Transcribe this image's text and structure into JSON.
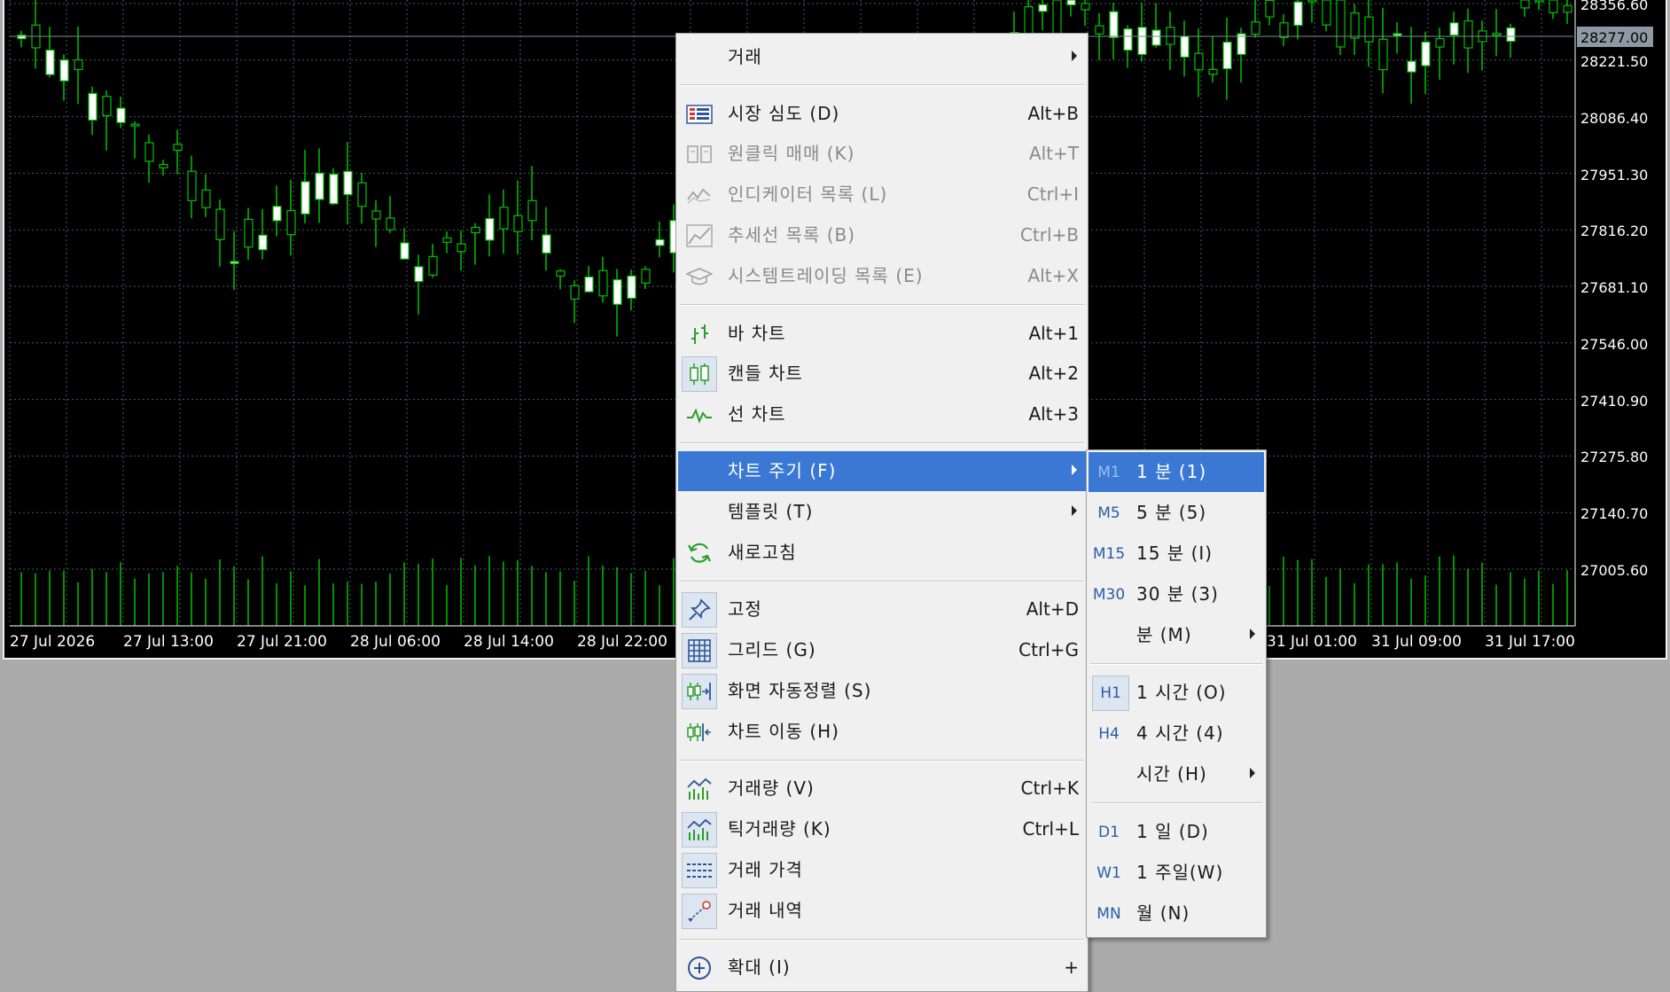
{
  "chart": {
    "price_ticks": [
      "28356.60",
      "28221.50",
      "28086.40",
      "27951.30",
      "27816.20",
      "27681.10",
      "27546.00",
      "27410.90",
      "27275.80",
      "27140.70",
      "27005.60"
    ],
    "current_price": "28277.00",
    "time_ticks": [
      "27 Jul 2026",
      "27 Jul 13:00",
      "27 Jul 21:00",
      "28 Jul 06:00",
      "28 Jul 14:00",
      "28 Jul 22:00",
      "31 Jul 01:00",
      "31 Jul 09:00",
      "31 Jul 17:00"
    ],
    "colors": {
      "background": "#000000",
      "grid": "#4a5a6a",
      "bull": "#00c000",
      "bear_body": "#ffffff",
      "volume": "#00c000"
    }
  },
  "context_menu": {
    "items": [
      {
        "label": "거래",
        "shortcut": "",
        "submenu": true
      },
      {
        "label": "시장 심도 (D)",
        "shortcut": "Alt+B",
        "icon": "market-depth-icon"
      },
      {
        "label": "원클릭 매매 (K)",
        "shortcut": "Alt+T",
        "icon": "one-click-trading-icon",
        "disabled": true
      },
      {
        "label": "인디케이터 목록 (L)",
        "shortcut": "Ctrl+I",
        "icon": "indicator-list-icon",
        "disabled": true
      },
      {
        "label": "추세선 목록 (B)",
        "shortcut": "Ctrl+B",
        "icon": "trendline-list-icon",
        "disabled": true
      },
      {
        "label": "시스템트레이딩 목록 (E)",
        "shortcut": "Alt+X",
        "icon": "expert-list-icon",
        "disabled": true
      },
      {
        "label": "바 차트",
        "shortcut": "Alt+1",
        "icon": "bar-chart-icon"
      },
      {
        "label": "캔들 차트",
        "shortcut": "Alt+2",
        "icon": "candle-chart-icon"
      },
      {
        "label": "선 차트",
        "shortcut": "Alt+3",
        "icon": "line-chart-icon"
      },
      {
        "label": "차트 주기 (F)",
        "shortcut": "",
        "submenu": true
      },
      {
        "label": "템플릿 (T)",
        "shortcut": "",
        "submenu": true
      },
      {
        "label": "새로고침",
        "shortcut": "",
        "icon": "refresh-icon"
      },
      {
        "label": "고정",
        "shortcut": "Alt+D",
        "icon": "pin-icon"
      },
      {
        "label": "그리드 (G)",
        "shortcut": "Ctrl+G",
        "icon": "grid-icon"
      },
      {
        "label": "화면 자동정렬 (S)",
        "shortcut": "",
        "icon": "autoscroll-icon"
      },
      {
        "label": "차트 이동 (H)",
        "shortcut": "",
        "icon": "chart-shift-icon"
      },
      {
        "label": "거래량 (V)",
        "shortcut": "Ctrl+K",
        "icon": "volume-icon"
      },
      {
        "label": "틱거래량 (K)",
        "shortcut": "Ctrl+L",
        "icon": "tick-volume-icon"
      },
      {
        "label": "거래 가격",
        "shortcut": "",
        "icon": "trade-levels-icon"
      },
      {
        "label": "거래 내역",
        "shortcut": "",
        "icon": "trade-history-icon"
      },
      {
        "label": "확대 (I)",
        "shortcut": "+",
        "icon": "zoom-in-icon"
      }
    ]
  },
  "timeframe_submenu": {
    "items": [
      {
        "code": "M1",
        "label": "1 분 (1)"
      },
      {
        "code": "M5",
        "label": "5 분 (5)"
      },
      {
        "code": "M15",
        "label": "15 분 (I)"
      },
      {
        "code": "M30",
        "label": "30 분 (3)"
      },
      {
        "code": "",
        "label": "분 (M)",
        "submenu": true
      },
      {
        "code": "H1",
        "label": "1 시간 (O)"
      },
      {
        "code": "H4",
        "label": "4 시간 (4)"
      },
      {
        "code": "",
        "label": "시간 (H)",
        "submenu": true
      },
      {
        "code": "D1",
        "label": "1 일 (D)"
      },
      {
        "code": "W1",
        "label": "1 주일(W)"
      },
      {
        "code": "MN",
        "label": "월 (N)"
      }
    ]
  }
}
